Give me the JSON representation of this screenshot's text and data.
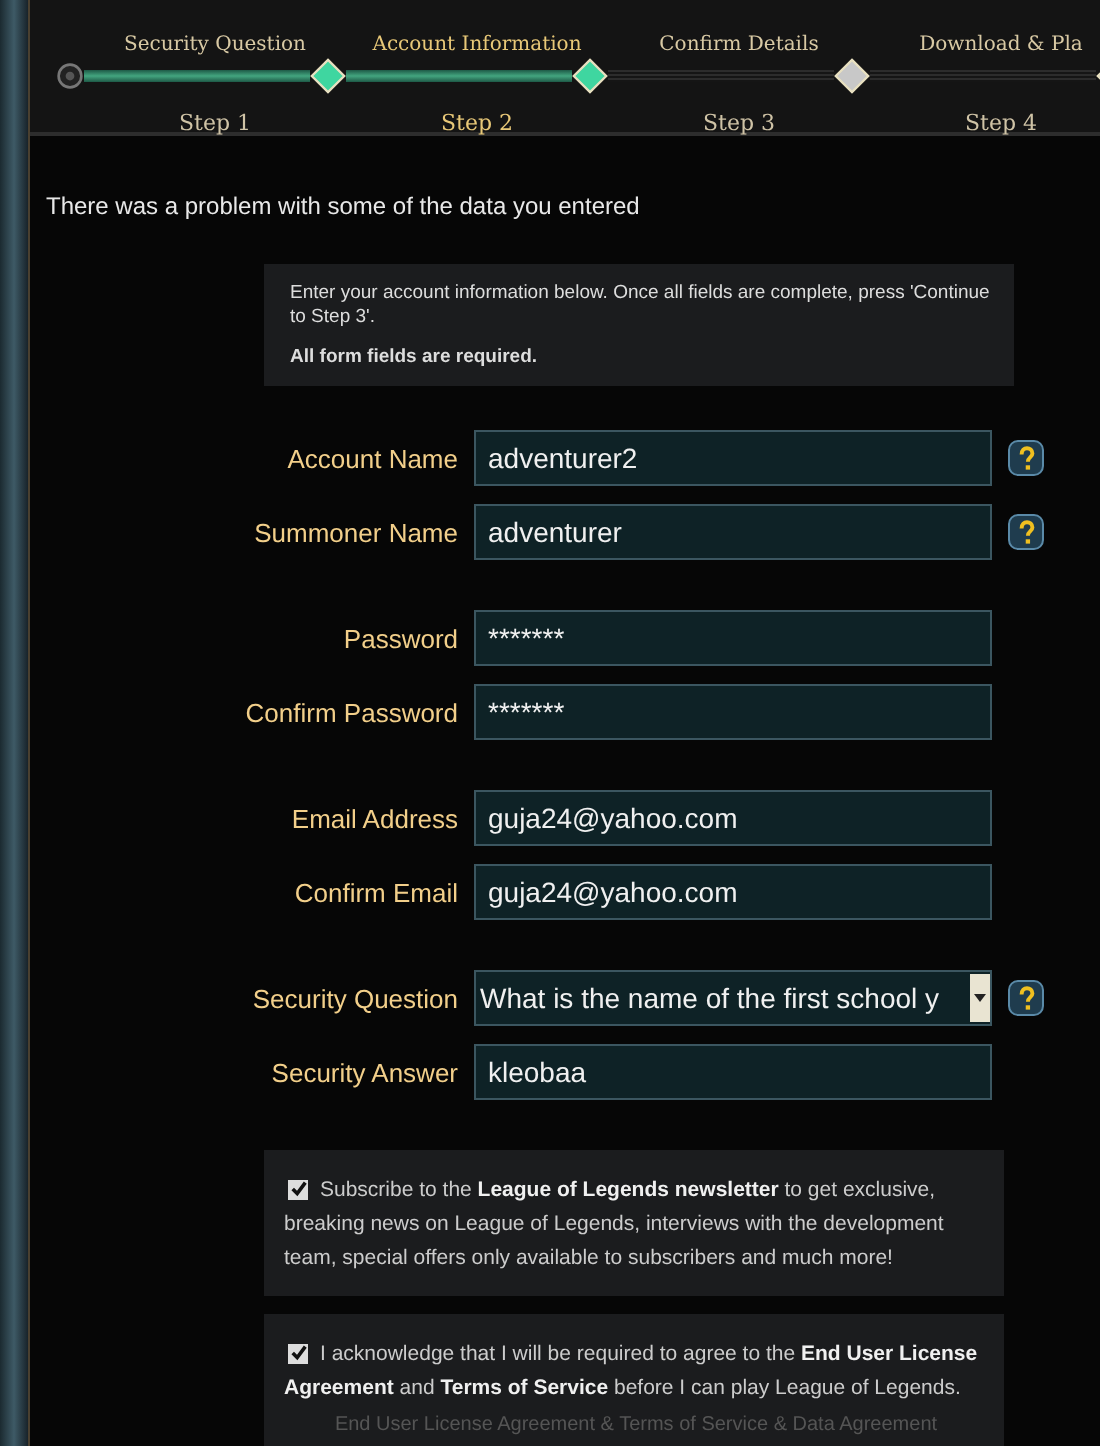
{
  "steps": [
    {
      "title": "Security Question",
      "label": "Step 1",
      "reached": true,
      "selected": false
    },
    {
      "title": "Account Information",
      "label": "Step 2",
      "reached": true,
      "selected": true
    },
    {
      "title": "Confirm Details",
      "label": "Step 3",
      "reached": false,
      "selected": false
    },
    {
      "title": "Download & Pla",
      "label": "Step 4",
      "reached": false,
      "selected": false
    }
  ],
  "error_message": "There was a problem with some of the data you entered",
  "info": {
    "text": "Enter your account information below. Once all fields are complete, press 'Continue to Step 3'.",
    "note": "All form fields are required."
  },
  "field_groups": [
    [
      {
        "label": "Account Name",
        "kind": "text",
        "value": "adventurer2",
        "help": true
      },
      {
        "label": "Summoner Name",
        "kind": "text",
        "value": "adventurer",
        "help": true
      }
    ],
    [
      {
        "label": "Password",
        "kind": "password",
        "value": "*******",
        "help": false
      },
      {
        "label": "Confirm Password",
        "kind": "password",
        "value": "*******",
        "help": false
      }
    ],
    [
      {
        "label": "Email Address",
        "kind": "text",
        "value": "guja24@yahoo.com",
        "help": false
      },
      {
        "label": "Confirm Email",
        "kind": "text",
        "value": "guja24@yahoo.com",
        "help": false
      }
    ],
    [
      {
        "label": "Security Question",
        "kind": "select",
        "value": "What is the name of the first school y",
        "help": true
      },
      {
        "label": "Security Answer",
        "kind": "text",
        "value": "kleobaa",
        "help": false
      }
    ]
  ],
  "consents": [
    {
      "text": "Subscribe to the **League of Legends newsletter** to get exclusive, breaking news on League of Legends, interviews with the development team, special offers only available to subscribers and much more!",
      "checked": true
    },
    {
      "text": "I acknowledge that I will be required to agree to the **End User License Agreement** and **Terms of Service** before I can play League of Legends.",
      "checked": true,
      "links": "End User License Agreement & Terms of Service & Data Agreement"
    }
  ]
}
